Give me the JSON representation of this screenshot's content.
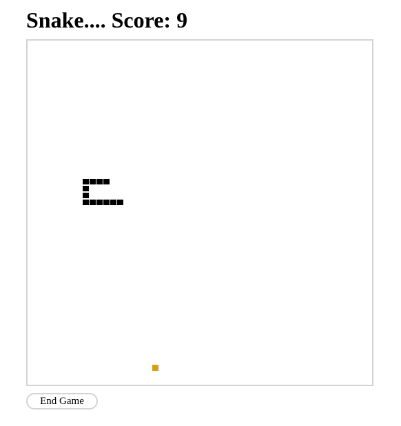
{
  "header": {
    "title": "Snake.... Score: 9"
  },
  "game": {
    "score": 9,
    "snake_color": "#000000",
    "food_color": "#d4a017",
    "board_border_color": "#d3d3d3"
  },
  "controls": {
    "end_game_label": "End Game"
  }
}
